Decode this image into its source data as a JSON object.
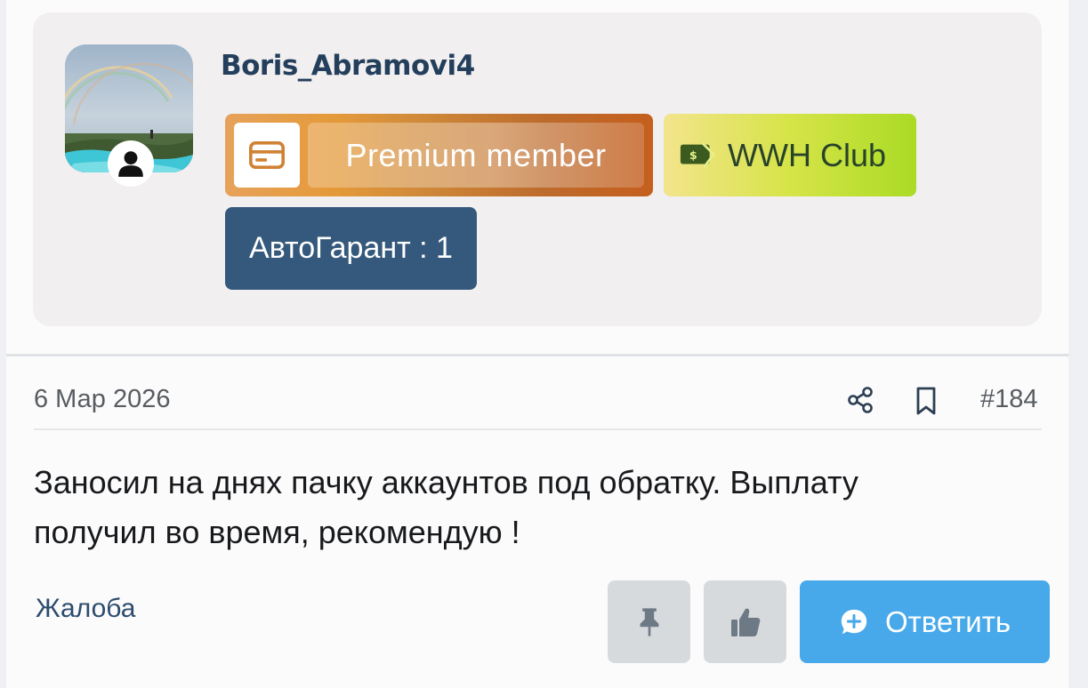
{
  "user": {
    "name": "Boris_Abramovi4",
    "banners": {
      "premium": "Premium member",
      "wwh": "WWH Club",
      "avto": "АвтоГарант : 1"
    }
  },
  "post": {
    "date": "6 Мар 2026",
    "number": "#184",
    "message_line1": "Заносил на днях пачку аккаунтов под обратку. Выплату",
    "message_line2": "получил во время, рекомендую !",
    "report": "Жалоба",
    "reply": "Ответить"
  },
  "icons": {
    "user": "user-icon",
    "card": "credit-card-icon",
    "money": "money-icon",
    "share": "share-icon",
    "bookmark": "bookmark-icon",
    "pin": "pin-icon",
    "like": "thumbs-up-icon",
    "reply": "reply-bubble-icon"
  },
  "colors": {
    "username": "#233f5c",
    "avto_banner": "#35597c",
    "reply_button": "#48a9ea",
    "neutral_button": "#d7dadd"
  }
}
